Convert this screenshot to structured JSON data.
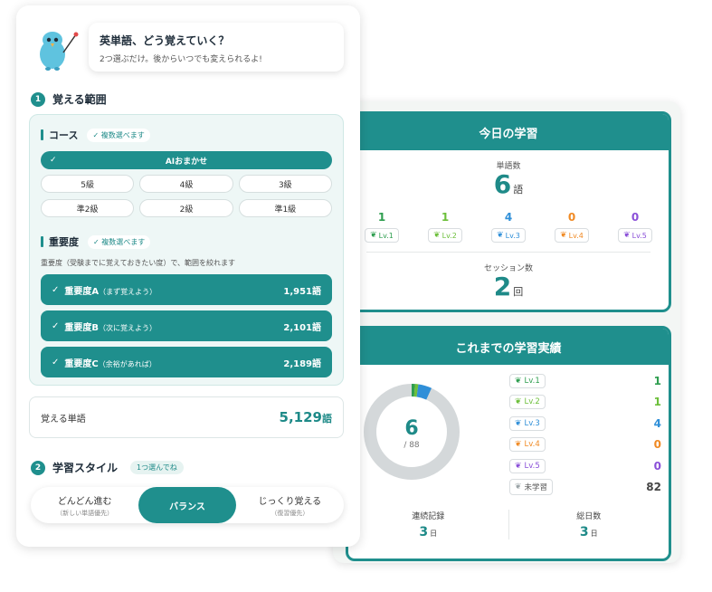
{
  "intro": {
    "title": "英単語、どう覚えていく？",
    "subtitle": "2つ選ぶだけ。後からいつでも変えられるよ!"
  },
  "step1": {
    "number": "1",
    "title": "覚える範囲"
  },
  "course": {
    "title": "コース",
    "multi_label": "✓ 複数選べます",
    "ai_option": "AIおまかせ",
    "grades": [
      "5級",
      "4級",
      "3級",
      "準2級",
      "2級",
      "準1級"
    ]
  },
  "importance": {
    "title": "重要度",
    "multi_label": "✓ 複数選べます",
    "description": "重要度（受験までに覚えておきたい度）で、範囲を絞れます",
    "options": [
      {
        "name": "重要度A",
        "note": "（まず覚えよう）",
        "count": "1,951語"
      },
      {
        "name": "重要度B",
        "note": "（次に覚えよう）",
        "count": "2,101語"
      },
      {
        "name": "重要度C",
        "note": "（余裕があれば）",
        "count": "2,189語"
      }
    ]
  },
  "total": {
    "label": "覚える単語",
    "value": "5,129",
    "unit": "語"
  },
  "step2": {
    "number": "2",
    "title": "学習スタイル",
    "pill": "1つ選んでね"
  },
  "style": {
    "options": [
      {
        "main": "どんどん進む",
        "sub": "（新しい単語優先）"
      },
      {
        "main": "バランス",
        "sub": ""
      },
      {
        "main": "じっくり覚える",
        "sub": "（復習優先）"
      }
    ],
    "selected": "バランス"
  },
  "today": {
    "header": "今日の学習",
    "words_label": "単語数",
    "words_value": "6",
    "words_unit": "語",
    "levels": [
      {
        "count": "1",
        "label": "Lv.1",
        "color": "#2e9e4f"
      },
      {
        "count": "1",
        "label": "Lv.2",
        "color": "#6cbf3a"
      },
      {
        "count": "4",
        "label": "Lv.3",
        "color": "#2f8fd8"
      },
      {
        "count": "0",
        "label": "Lv.4",
        "color": "#f08a24"
      },
      {
        "count": "0",
        "label": "Lv.5",
        "color": "#8a4fd8"
      }
    ],
    "sessions_label": "セッション数",
    "sessions_value": "2",
    "sessions_unit": "回"
  },
  "history": {
    "header": "これまでの学習実績",
    "learned": "6",
    "total": "/ 88",
    "legend": [
      {
        "label": "Lv.1",
        "value": "1",
        "color": "#2e9e4f"
      },
      {
        "label": "Lv.2",
        "value": "1",
        "color": "#6cbf3a"
      },
      {
        "label": "Lv.3",
        "value": "4",
        "color": "#2f8fd8"
      },
      {
        "label": "Lv.4",
        "value": "0",
        "color": "#f08a24"
      },
      {
        "label": "Lv.5",
        "value": "0",
        "color": "#8a4fd8"
      },
      {
        "label": "未学習",
        "value": "82",
        "color": "#9aa3a6"
      }
    ],
    "streak_label": "連続記録",
    "streak_value": "3",
    "streak_unit": "日",
    "total_days_label": "総日数",
    "total_days_value": "3",
    "total_days_unit": "日"
  },
  "colors": {
    "accent": "#1f8f8d",
    "unlearned": "#d4d8da"
  }
}
